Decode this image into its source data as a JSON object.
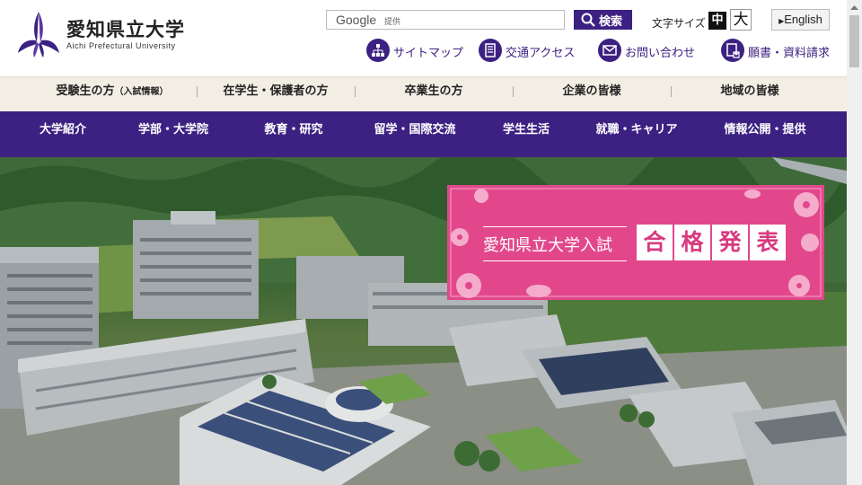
{
  "header": {
    "logo_jp": "愛知県立大学",
    "logo_en": "Aichi Prefectural University",
    "search_brand": "Google",
    "search_provided": "提供",
    "search_button": "検索",
    "fontsize_label": "文字サイズ",
    "fontsize_mid": "中",
    "fontsize_large": "大",
    "english_label": "English"
  },
  "utility": [
    {
      "label": "サイトマップ",
      "icon": "sitemap-icon"
    },
    {
      "label": "交通アクセス",
      "icon": "building-icon"
    },
    {
      "label": "お問い合わせ",
      "icon": "mail-icon"
    },
    {
      "label": "願書・資料請求",
      "icon": "document-request-icon"
    }
  ],
  "audience_nav": [
    {
      "label": "受験生の方",
      "sub": "（入試情報）"
    },
    {
      "label": "在学生・保護者の方",
      "sub": ""
    },
    {
      "label": "卒業生の方",
      "sub": ""
    },
    {
      "label": "企業の皆様",
      "sub": ""
    },
    {
      "label": "地域の皆様",
      "sub": ""
    }
  ],
  "main_nav": [
    {
      "label": "大学紹介"
    },
    {
      "label": "学部・大学院"
    },
    {
      "label": "教育・研究"
    },
    {
      "label": "留学・国際交流"
    },
    {
      "label": "学生生活"
    },
    {
      "label": "就職・キャリア"
    },
    {
      "label": "情報公開・提供"
    }
  ],
  "banner": {
    "text": "愛知県立大学入試",
    "chars": [
      "合",
      "格",
      "発",
      "表"
    ]
  },
  "colors": {
    "brand": "#3d2182",
    "audience_bg": "#f2eee4",
    "banner_pink": "#e2478c"
  }
}
